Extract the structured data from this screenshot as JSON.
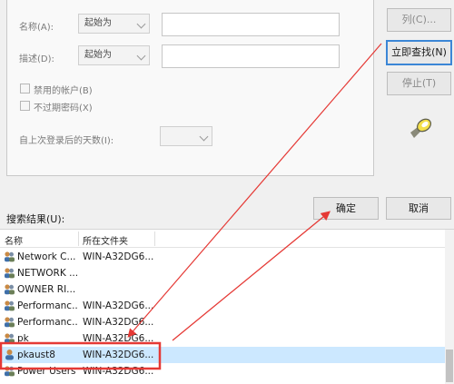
{
  "form": {
    "name_label": "名称(A):",
    "desc_label": "描述(D):",
    "name_mode": "起始为",
    "desc_mode": "起始为",
    "disabled_accounts": "禁用的帐户(B)",
    "non_expiring": "不过期密码(X)",
    "days_since_logon": "自上次登录后的天数(I):"
  },
  "buttons": {
    "columns": "列(C)...",
    "find_now": "立即查找(N)",
    "stop": "停止(T)",
    "ok": "确定",
    "cancel": "取消"
  },
  "results": {
    "label": "搜索结果(U):",
    "col_name": "名称",
    "col_folder": "所在文件夹",
    "rows": [
      {
        "name": "Network C...",
        "folder": "WIN-A32DG6..."
      },
      {
        "name": "NETWORK ...",
        "folder": ""
      },
      {
        "name": "OWNER RI...",
        "folder": ""
      },
      {
        "name": "Performanc...",
        "folder": "WIN-A32DG6..."
      },
      {
        "name": "Performanc...",
        "folder": "WIN-A32DG6..."
      },
      {
        "name": "pk",
        "folder": "WIN-A32DG6..."
      },
      {
        "name": "pkaust8",
        "folder": "WIN-A32DG6..."
      },
      {
        "name": "Power Users",
        "folder": "WIN-A32DG6..."
      }
    ]
  },
  "colors": {
    "annotation": "#e53935",
    "selection": "#cce8ff",
    "primary_border": "#3b86d6"
  }
}
